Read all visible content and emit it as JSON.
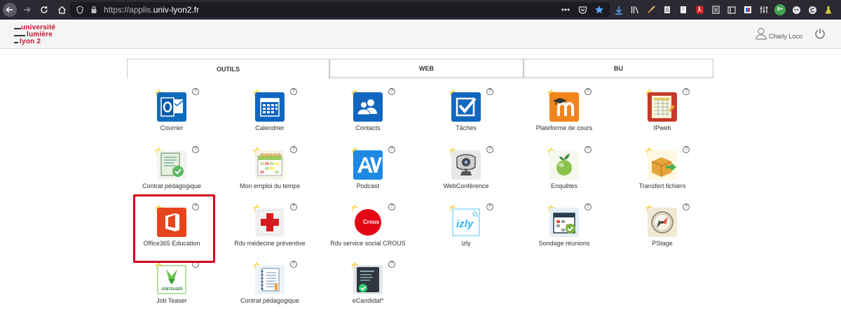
{
  "browser": {
    "url_prefix": "https://applis.",
    "url_domain": "univ-lyon2.fr",
    "url_more": "•••",
    "addon_badge": "8+"
  },
  "header": {
    "logo_lines": [
      "université",
      "lumière",
      "lyon 2"
    ],
    "user_name": "Charly Loco"
  },
  "tabs": [
    {
      "label": "OUTILS",
      "active": true
    },
    {
      "label": "WEB",
      "active": false
    },
    {
      "label": "BU",
      "active": false
    }
  ],
  "help_glyph": "?",
  "tiles": [
    {
      "label": "Courrier",
      "icon": "outlook-icon"
    },
    {
      "label": "Calendrier",
      "icon": "calendar-icon"
    },
    {
      "label": "Contacts",
      "icon": "contacts-icon"
    },
    {
      "label": "Tâches",
      "icon": "tasks-icon"
    },
    {
      "label": "Plateforme de cours",
      "icon": "moodle-icon"
    },
    {
      "label": "IPweb",
      "icon": "ipweb-icon"
    },
    {
      "label": "Contrat pédagogique",
      "icon": "contract-icon"
    },
    {
      "label": "Mon emploi du temps",
      "icon": "timetable-icon"
    },
    {
      "label": "Podcast",
      "icon": "podcast-icon"
    },
    {
      "label": "WebConférence",
      "icon": "webcam-icon"
    },
    {
      "label": "Enquêtes",
      "icon": "survey-lime-icon"
    },
    {
      "label": "Transfert fichiers",
      "icon": "file-transfer-icon"
    },
    {
      "label": "Office365 Education",
      "icon": "office365-icon"
    },
    {
      "label": "Rdv médecine préventive",
      "icon": "medical-cross-icon"
    },
    {
      "label": "Rdv service social CROUS",
      "icon": "crous-icon",
      "icon_text": "Crous"
    },
    {
      "label": "izly",
      "icon": "izly-icon",
      "icon_text": "izly"
    },
    {
      "label": "Sondage réunions",
      "icon": "meeting-poll-icon"
    },
    {
      "label": "PStage",
      "icon": "compass-icon"
    },
    {
      "label": "Job Teaser",
      "icon": "jobteaser-icon",
      "icon_text": "JOBTEASER"
    },
    {
      "label": "Contrat pédagogique",
      "icon": "contract-notebook-icon"
    },
    {
      "label": "eCandidat*",
      "icon": "ecandidat-icon"
    }
  ],
  "colors": {
    "highlight": "#d0021b",
    "star": "#f5c400",
    "office": "#e5451d",
    "outlook": "#0f6cbd",
    "moodle": "#f2841c",
    "crous": "#e30613"
  }
}
